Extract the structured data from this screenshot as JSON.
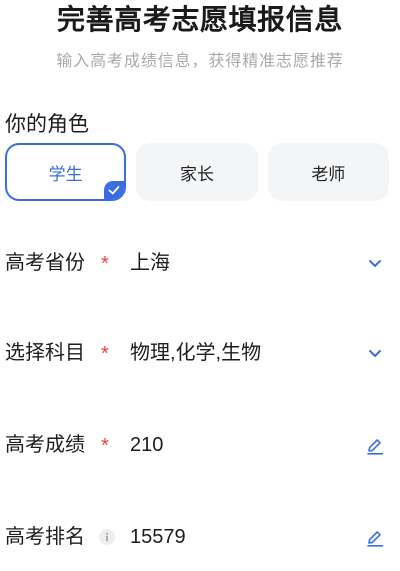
{
  "header": {
    "title": "完善高考志愿填报信息",
    "subtitle": "输入高考成绩信息，获得精准志愿推荐"
  },
  "role": {
    "label": "你的角色",
    "options": [
      {
        "label": "学生",
        "selected": true
      },
      {
        "label": "家长",
        "selected": false
      },
      {
        "label": "老师",
        "selected": false
      }
    ],
    "selected_icon": "check-badge-icon"
  },
  "form": {
    "required_mark": "*",
    "province": {
      "label": "高考省份",
      "required": true,
      "value": "上海",
      "icon": "chevron-down-icon"
    },
    "subjects": {
      "label": "选择科目",
      "required": true,
      "value": "物理,化学,生物",
      "icon": "chevron-down-icon"
    },
    "score": {
      "label": "高考成绩",
      "required": true,
      "value": "210",
      "icon": "edit-icon"
    },
    "rank": {
      "label": "高考排名",
      "required": false,
      "hint_icon": "info-icon",
      "value": "15579",
      "icon": "edit-icon"
    }
  },
  "colors": {
    "accent": "#3a6de2",
    "required": "#e8433a",
    "text": "#1d1d1d",
    "muted": "#a8a8a8",
    "option_bg": "#f4f5f7"
  }
}
